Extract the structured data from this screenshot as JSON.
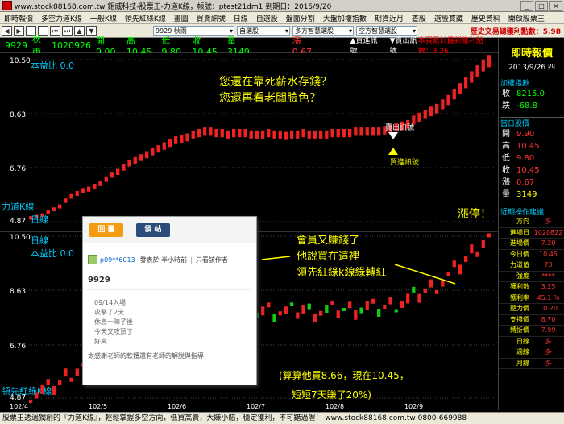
{
  "titlebar": {
    "title": "www.stock88168.com.tw 鉅威科技-股票王-力道K線，帳號：ptest21dm1 到期日：2015/9/20"
  },
  "menu": {
    "items": [
      "即時報價",
      "多空力道K線",
      "一般K線",
      "領先紅綠K線",
      "畫圖",
      "買賣訊號",
      "日線",
      "自選股",
      "盤面分割",
      "大盤加權指數",
      "期貨近月",
      "查股",
      "選股寶藏",
      "歷史資料",
      "開啟股票王"
    ],
    "right_label": "歷史交易獲利統計"
  },
  "toolbar": {
    "stock_select": "9929 秋雨",
    "select2": "自選股",
    "select3": "多方智慧選股",
    "select4": "空方智慧選股",
    "history_label": "歷史交易總獲利點數：5.98"
  },
  "quote": {
    "code": "9929",
    "name": "秋雨",
    "date": "1020926",
    "open": "開 9.90",
    "high": "高 10.45",
    "low": "低 9.80",
    "close": "收 10.45",
    "volume": "量 3149",
    "change": "漲 0.67",
    "buy_signal": "▲買進訊號",
    "sell_signal": "▼賣出訊號",
    "rank": "本頁累計最新獲利點數：3.26"
  },
  "chart_data": [
    {
      "type": "bar",
      "name": "力道K線",
      "title": "本益比 0.0",
      "y_ticks": [
        "10.50",
        "8.63",
        "6.76",
        "4.87"
      ],
      "ylim": [
        4.87,
        10.5
      ],
      "x_ticks": [
        "102/4",
        "102/5",
        "102/6",
        "102/7",
        "102/8",
        "102/9"
      ],
      "values": [
        5.0,
        5.05,
        5.1,
        5.2,
        5.3,
        5.4,
        5.6,
        5.75,
        5.85,
        5.95,
        6.0,
        6.1,
        6.2,
        6.35,
        6.5,
        6.6,
        6.75,
        6.9,
        7.0,
        7.1,
        7.2,
        7.3,
        7.4,
        7.5,
        7.6,
        7.7,
        7.75,
        7.8,
        7.9,
        7.95,
        8.0,
        8.0,
        7.95,
        7.95,
        7.9,
        7.95,
        7.95,
        7.95,
        7.9,
        7.9,
        7.9,
        7.95,
        7.9,
        7.9,
        7.85,
        7.9,
        7.9,
        7.95,
        7.9,
        7.9,
        7.9,
        7.9,
        7.95,
        7.95,
        7.95,
        7.95,
        8.0,
        8.0,
        8.0,
        8.0,
        8.0,
        8.05,
        8.1,
        8.15,
        8.2,
        8.25,
        8.4,
        8.5,
        8.6,
        8.7,
        8.8,
        8.95,
        9.1,
        9.3,
        9.5,
        9.7,
        9.9,
        10.1,
        10.3,
        10.45
      ]
    },
    {
      "type": "bar",
      "name": "領先紅綠K線",
      "title": "本益比 0.0",
      "y_ticks": [
        "10.50",
        "8.63",
        "6.76",
        "4.87"
      ],
      "ylim": [
        4.87,
        10.5
      ],
      "x_ticks": [
        "102/4",
        "102/5",
        "102/6",
        "102/7",
        "102/8",
        "102/9"
      ]
    }
  ],
  "chart_labels": {
    "top_label": "日線",
    "top_pe": "本益比 0.0",
    "top_name": "力道K線",
    "bottom_label": "日線",
    "bottom_pe": "本益比 0.0",
    "bottom_name": "領先紅綠K線",
    "ann1": "您還在靠死薪水存錢？",
    "ann2": "您還再看老闆臉色？",
    "sell_sig": "賣出訊號",
    "buy_sig": "買進訊號",
    "rise": "漲停！",
    "ann3": "會員又賺錢了",
    "ann4": "他說買在這裡",
    "ann5": "領先紅綠k線綠轉紅",
    "ann6": "(算算他買8.66，現在10.45，",
    "ann7": "短短7天賺了20%)"
  },
  "popup": {
    "reply": "回 覆",
    "post": "發 帖",
    "user": "p09**6013",
    "time": "發表於 半小時前",
    "view": "只看該作者",
    "stock": "9929",
    "l1": "09/14入場",
    "l2": "攻擊了2天",
    "l3": "休息一陣子後",
    "l4": "今天又攻頂了",
    "l5": "好爽",
    "foot": "太感謝老師的軟體還有老師的解說與指導"
  },
  "rightpanel": {
    "title": "即時報價",
    "date": "2013/9/26 四",
    "idx_title": "加權指數",
    "idx_close_k": "收",
    "idx_close_v": "8215.0",
    "idx_chg_k": "跌",
    "idx_chg_v": "-68.8",
    "day_title": "當日股價",
    "open_k": "開",
    "open_v": "9.90",
    "high_k": "高",
    "high_v": "10.45",
    "low_k": "低",
    "low_v": "9.80",
    "close_k": "收",
    "close_v": "10.45",
    "chg_k": "漲",
    "chg_v": "0.67",
    "vol_k": "量",
    "vol_v": "3149",
    "op_title": "近期操作建議",
    "op": [
      {
        "k": "方向",
        "v": "多"
      },
      {
        "k": "進場日",
        "v": "1020822"
      },
      {
        "k": "進場價",
        "v": "7.20"
      },
      {
        "k": "今日價",
        "v": "10.45"
      },
      {
        "k": "力道值",
        "v": "70"
      },
      {
        "k": "強度",
        "v": "****"
      },
      {
        "k": "獲利數",
        "v": "3.25"
      },
      {
        "k": "獲利率",
        "v": "45.1 %"
      },
      {
        "k": "壓力價",
        "v": "10.20"
      },
      {
        "k": "支撐價",
        "v": "8.70"
      },
      {
        "k": "轉折價",
        "v": "7.99"
      },
      {
        "k": "日線",
        "v": "多"
      },
      {
        "k": "週線",
        "v": "多"
      },
      {
        "k": "月線",
        "v": "多"
      }
    ]
  },
  "statusbar": {
    "text": "股票王透過獨創的『力道K線』，輕鬆掌握多空方向，低買高賣，大賺小賠，穩定獲利，不可錯過喔！  www.stock88168.com.tw  0800-669988"
  }
}
